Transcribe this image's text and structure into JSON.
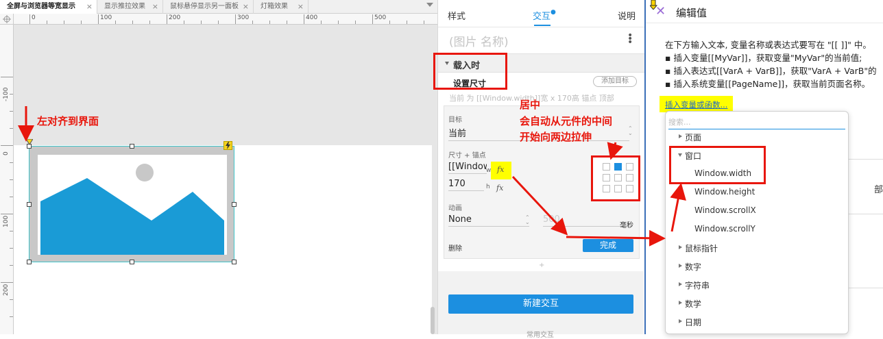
{
  "tabs": [
    {
      "label": "全屏与浏览器等宽显示",
      "active": true
    },
    {
      "label": "显示推拉效果",
      "active": false
    },
    {
      "label": "鼠标悬停显示另一面板",
      "active": false
    },
    {
      "label": "灯箱效果",
      "active": false
    }
  ],
  "ruler": {
    "h": [
      "0",
      "100",
      "200",
      "300",
      "400",
      "500"
    ],
    "v": [
      "-100",
      "0",
      "100",
      "200"
    ]
  },
  "annotations": {
    "left_align": "左对齐到界面",
    "center_line1": "居中",
    "center_line2": "会自动从元件的中间",
    "center_line3": "开始向两边拉伸"
  },
  "panel": {
    "tabs": {
      "style": "样式",
      "interaction": "交互",
      "notes": "说明"
    },
    "widget_name": "(图片 名称)",
    "event": "载入时",
    "action": "设置尺寸",
    "add_target": "添加目标",
    "action_desc": "当前 为 [[Window.width]]宽 x 170高 锚点 顶部",
    "target_label": "目标",
    "target_value": "当前",
    "size_label": "尺寸 + 锚点",
    "width_value": "[[Window",
    "width_unit": "w",
    "height_value": "170",
    "height_unit": "h",
    "anim_label": "动画",
    "anim_value": "None",
    "duration_value": "500",
    "duration_unit": "毫秒",
    "delete_label": "删除",
    "done_label": "完成",
    "new_interaction": "新建交互",
    "common_interaction": "常用交互"
  },
  "dialog": {
    "title": "编辑值",
    "lines": [
      "在下方输入文本, 变量名称或表达式要写在 \"[[ ]]\" 中。",
      "▪ 插入变量[[MyVar]]，获取变量\"MyVar\"的当前值;",
      "▪ 插入表达式[[VarA + VarB]]，获取\"VarA + VarB\"的",
      "▪ 插入系统变量[[PageName]]，获取当前页面名称。"
    ],
    "insert_link": "插入变量或函数...",
    "bg_text": "部变量名",
    "search_placeholder": "搜索...",
    "items": {
      "page": "页面",
      "window": "窗口",
      "width": "Window.width",
      "height": "Window.height",
      "scrollx": "Window.scrollX",
      "scrolly": "Window.scrollY",
      "cursor": "鼠标指针",
      "number": "数字",
      "string": "字符串",
      "math": "数学",
      "date": "日期"
    }
  },
  "colors": {
    "accent": "#1c8fe0",
    "annotation": "#e8160c",
    "highlight": "#ffff00",
    "image": "#1a9bd6"
  }
}
